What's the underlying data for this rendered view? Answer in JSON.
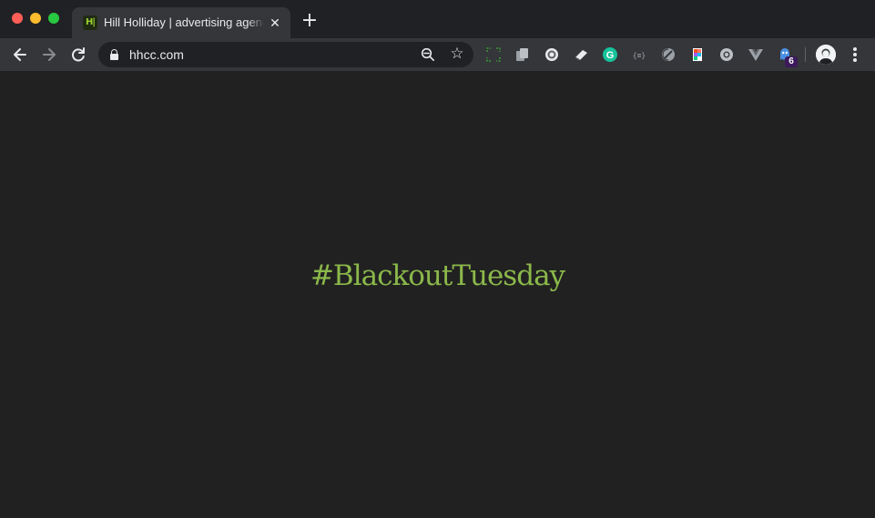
{
  "browser": {
    "tab": {
      "favicon_text": "H|",
      "title": "Hill Holliday | advertising agency",
      "close_glyph": "✕"
    },
    "new_tab_glyph": "+",
    "url": "hhcc.com",
    "extensions": [
      "screenshot-icon",
      "docs-icon",
      "record-icon",
      "eraser-icon",
      "grammarly-icon",
      "json-icon",
      "shield-icon",
      "figma-icon",
      "chrome-icon",
      "vue-icon",
      "ghostery-icon"
    ],
    "ghostery_badge": "6"
  },
  "page": {
    "headline": "#BlackoutTuesday"
  },
  "colors": {
    "accent": "#8bb84a",
    "background": "#212121",
    "toolbar": "#35363a"
  }
}
